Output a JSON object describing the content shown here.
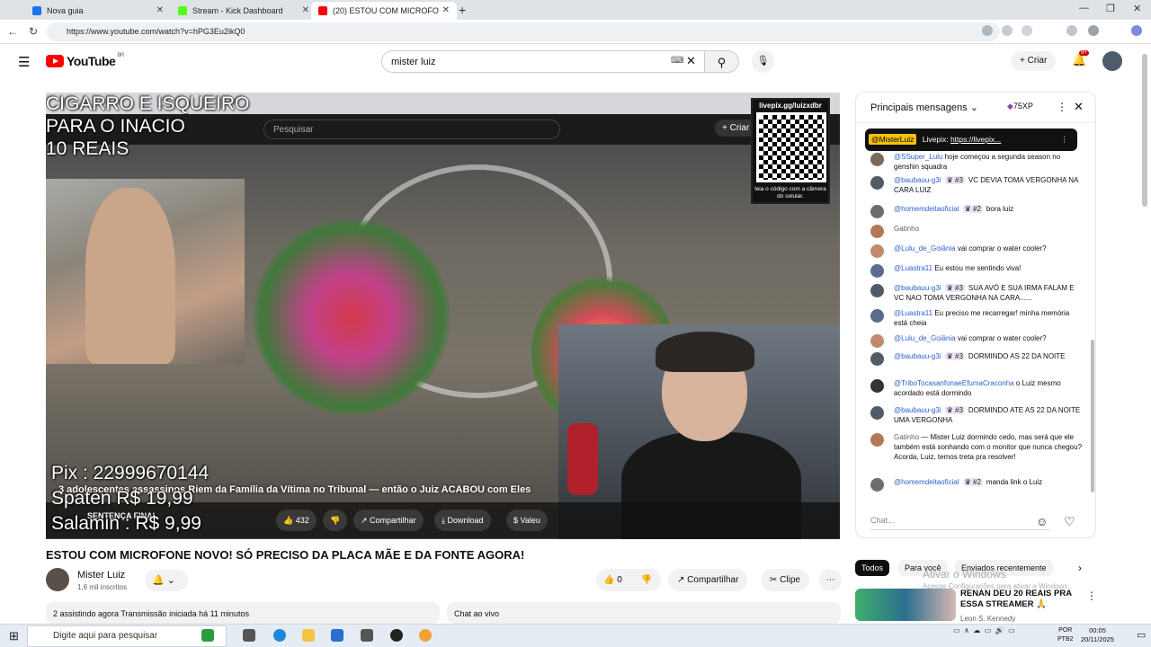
{
  "browser": {
    "tabs": [
      {
        "label": "Nova guia",
        "color": "#1a73e8"
      },
      {
        "label": "Stream - Kick Dashboard",
        "color": "#53fc18"
      },
      {
        "label": "(20) ESTOU COM MICROFO",
        "color": "#ff0000"
      }
    ],
    "url": "https://www.youtube.com/watch?v=hPG3Eu2ikQ0"
  },
  "youtube": {
    "logo_text": "YouTube",
    "region": "BR",
    "search_value": "mister luiz",
    "create_label": "Criar",
    "notif_count": "9+"
  },
  "video": {
    "overlay_lines": [
      "CIGARRO E ISQUEIRO",
      "PARA O INACIO",
      "10 REAIS"
    ],
    "pix_lines": [
      "Pix : 22999670144",
      "Spaten R$ 19,99",
      "Salamin : R$ 9,99"
    ],
    "inner_search_placeholder": "Pesquisar",
    "inner_create": "Criar",
    "inner_title": "3 adolescentes assassinos Riem da Família da Vítima no Tribunal — então o Juiz ACABOU com Eles",
    "inner_channel": "SENTENÇA FINAL",
    "inner_likes": "432",
    "inner_share": "Compartilhar",
    "inner_download": "Download",
    "inner_thanks": "Valeu",
    "qr_url": "livepix.gg/luizxdbr",
    "qr_caption": "leia o código com a câmera do celular."
  },
  "below": {
    "title": "ESTOU COM MICROFONE NOVO! SÓ PRECISO DA PLACA MÃE E DA FONTE AGORA!",
    "channel": "Mister Luiz",
    "subs": "1,6 mil inscritos",
    "likes": "0",
    "share": "Compartilhar",
    "clip": "Clipe",
    "stats": "2 assistindo agora  Transmissão iniciada há 11 minutos",
    "chat_live": "Chat ao vivo"
  },
  "chat": {
    "title": "Principais mensagens",
    "xp": "75XP",
    "pinned_author": "@MisterLuiz",
    "pinned_text": "Livepix:",
    "pinned_link": "https://livepix...",
    "messages": [
      {
        "author": "@SSuper_Lulu",
        "badge": "",
        "text": "hoje começou a segunda season no genshin squadra",
        "color": "#7a6a5a"
      },
      {
        "author": "@baubauu-g3i",
        "badge": "#3",
        "text": "VC DEVIA TOMA VERGONHA NA CARA LUIZ",
        "color": "#4f5b66"
      },
      {
        "author": "@homemdeitaoficial",
        "badge": "#2",
        "text": "bora luiz",
        "color": "#6d6d6d"
      },
      {
        "author": "Gatinho",
        "badge": "",
        "text": "",
        "color": "#b07a5a"
      },
      {
        "author": "@Lulu_de_Goiânia",
        "badge": "",
        "text": "vai comprar o water cooler?",
        "color": "#c28a6a"
      },
      {
        "author": "@Luastra11",
        "badge": "",
        "text": "Eu estou me sentindo viva!",
        "color": "#5b6b8b"
      },
      {
        "author": "@baubauu-g3i",
        "badge": "#3",
        "text": "SUA AVÓ E SUA IRMA FALAM E VC NAO TOMA VERGONHA NA CARA......",
        "color": "#4f5b66"
      },
      {
        "author": "@Luastra11",
        "badge": "",
        "text": "Eu preciso me recarregar! minha memória está cheia",
        "color": "#5b6b8b"
      },
      {
        "author": "@Lulu_de_Goiânia",
        "badge": "",
        "text": "vai comprar o water cooler?",
        "color": "#c28a6a"
      },
      {
        "author": "@baubauu-g3i",
        "badge": "#3",
        "text": "DORMINDO AS 22 DA NOITE",
        "color": "#4f5b66"
      },
      {
        "author": "@TriboTocasanfonaeEfumaCraconha",
        "badge": "",
        "text": "o Luiz mesmo acordado está dormindo",
        "color": "#333333"
      },
      {
        "author": "@baubauu-g3i",
        "badge": "#3",
        "text": "DORMINDO ATE AS 22 DA NOITE UMA VERGONHA",
        "color": "#4f5b66"
      },
      {
        "author": "Gatinho",
        "badge": "",
        "text": "— Mister Luiz dormindo cedo, mas será que ele também está sonhando com o monitor que nunca chegou? Acorda, Luiz, temos treta pra resolver!",
        "color": "#b07a5a"
      },
      {
        "author": "@homemdeitaoficial",
        "badge": "#2",
        "text": "manda link o Luiz",
        "color": "#6d6d6d"
      }
    ],
    "input_placeholder": "Chat..."
  },
  "recs": {
    "chips": [
      "Todos",
      "Para você",
      "Enviados recentemente"
    ],
    "title": "RENAN DEU 20 REAIS PRA ESSA STREAMER 🙏",
    "channel": "Leon S. Kennedy",
    "watermark_1": "Ativar o Windows",
    "watermark_2": "Acesse Configurações para ativar o Windows."
  },
  "taskbar": {
    "search_placeholder": "Digite aqui para pesquisar",
    "lang": "POR",
    "lang2": "PTB2",
    "time": "00:05",
    "date": "20/11/2025"
  }
}
